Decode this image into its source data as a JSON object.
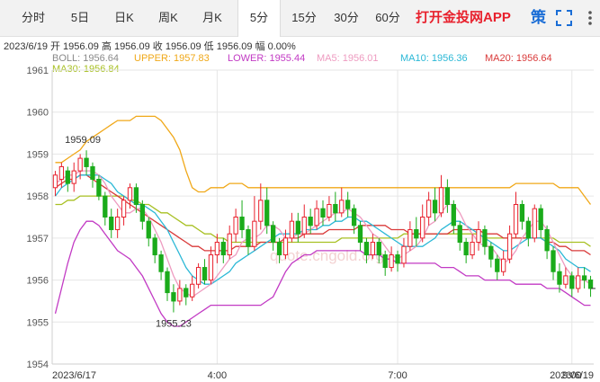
{
  "tabs": [
    {
      "label": "分时",
      "active": false
    },
    {
      "label": "5日",
      "active": false
    },
    {
      "label": "日K",
      "active": false
    },
    {
      "label": "周K",
      "active": false
    },
    {
      "label": "月K",
      "active": false
    },
    {
      "label": "5分",
      "active": true
    },
    {
      "label": "15分",
      "active": false
    },
    {
      "label": "30分",
      "active": false
    },
    {
      "label": "60分",
      "active": false
    }
  ],
  "app_link": "打开金投网APP",
  "strategy": "策",
  "icons": {
    "fullscreen": "fullscreen-icon",
    "more": "more-vertical-icon"
  },
  "info": {
    "date": "2023/6/19",
    "open": "开 1956.09",
    "high": "高 1956.09",
    "close": "收 1956.09",
    "low": "低 1956.09",
    "amplitude": "幅 0.00%"
  },
  "legend": {
    "boll": "BOLL: 1956.64",
    "upper": "UPPER: 1957.83",
    "lower": "LOWER: 1955.44",
    "ma5": "MA5: 1956.01",
    "ma10": "MA10: 1956.36",
    "ma20": "MA20: 1956.64",
    "ma30": "MA30: 1956.84"
  },
  "colors": {
    "up": "#e8212d",
    "down": "#1aab1a",
    "upper": "#f0a818",
    "lower": "#c23ac4",
    "boll": "#9a9a9a",
    "ma5": "#ee9bc0",
    "ma10": "#2bb8d6",
    "ma20": "#d93a3a",
    "ma30": "#a8c023",
    "grid": "#e6e6e6"
  },
  "watermark": "quote.cngold.org",
  "chart_data": {
    "type": "candlestick",
    "ylim": [
      1954,
      1961
    ],
    "yticks": [
      "1961",
      "1960",
      "1959",
      "1958",
      "1957",
      "1956",
      "1955",
      "1954"
    ],
    "xticks": [
      "2023/6/17",
      "4:00",
      "7:00",
      "9:00",
      "2023/6/19"
    ],
    "annotations": [
      {
        "text": "1959.09"
      },
      {
        "text": "1955.23"
      }
    ],
    "candles": [
      [
        1958.2,
        1958.5,
        1958.0,
        1958.6
      ],
      [
        1958.4,
        1958.7,
        1958.2,
        1958.8
      ],
      [
        1958.6,
        1958.3,
        1958.1,
        1958.7
      ],
      [
        1958.3,
        1958.6,
        1958.1,
        1958.8
      ],
      [
        1958.6,
        1958.9,
        1958.4,
        1959.0
      ],
      [
        1958.9,
        1958.7,
        1958.5,
        1959.09
      ],
      [
        1958.7,
        1958.4,
        1958.2,
        1958.8
      ],
      [
        1958.4,
        1958.0,
        1957.9,
        1958.5
      ],
      [
        1958.0,
        1957.5,
        1957.3,
        1958.1
      ],
      [
        1957.5,
        1957.2,
        1957.0,
        1957.7
      ],
      [
        1957.2,
        1957.5,
        1957.0,
        1957.7
      ],
      [
        1957.5,
        1957.9,
        1957.3,
        1958.0
      ],
      [
        1957.9,
        1958.2,
        1957.7,
        1958.3
      ],
      [
        1958.2,
        1957.8,
        1957.6,
        1958.3
      ],
      [
        1957.8,
        1957.4,
        1957.2,
        1957.9
      ],
      [
        1957.4,
        1957.0,
        1956.8,
        1957.5
      ],
      [
        1957.0,
        1956.6,
        1956.4,
        1957.1
      ],
      [
        1956.6,
        1956.2,
        1956.0,
        1956.7
      ],
      [
        1956.2,
        1955.7,
        1955.5,
        1956.3
      ],
      [
        1955.7,
        1955.5,
        1955.23,
        1955.9
      ],
      [
        1955.5,
        1955.8,
        1955.4,
        1956.0
      ],
      [
        1955.8,
        1955.6,
        1955.4,
        1955.9
      ],
      [
        1955.6,
        1955.9,
        1955.5,
        1956.1
      ],
      [
        1955.9,
        1956.3,
        1955.8,
        1956.4
      ],
      [
        1956.3,
        1956.0,
        1955.9,
        1956.5
      ],
      [
        1956.0,
        1956.6,
        1955.9,
        1956.8
      ],
      [
        1956.6,
        1956.9,
        1956.4,
        1957.1
      ],
      [
        1956.9,
        1956.6,
        1956.4,
        1957.0
      ],
      [
        1956.6,
        1957.1,
        1956.5,
        1957.3
      ],
      [
        1957.1,
        1957.5,
        1956.9,
        1957.7
      ],
      [
        1957.5,
        1957.2,
        1957.0,
        1957.9
      ],
      [
        1957.2,
        1956.8,
        1956.6,
        1957.3
      ],
      [
        1956.8,
        1957.4,
        1956.7,
        1958.0
      ],
      [
        1957.4,
        1957.9,
        1957.2,
        1958.3
      ],
      [
        1957.9,
        1957.3,
        1957.1,
        1958.2
      ],
      [
        1957.3,
        1956.9,
        1956.7,
        1957.4
      ],
      [
        1956.9,
        1956.6,
        1956.4,
        1957.0
      ],
      [
        1956.6,
        1957.0,
        1956.5,
        1957.2
      ],
      [
        1957.0,
        1957.4,
        1956.9,
        1957.6
      ],
      [
        1957.4,
        1957.1,
        1956.9,
        1957.6
      ],
      [
        1957.1,
        1957.5,
        1957.0,
        1957.8
      ],
      [
        1957.5,
        1957.3,
        1957.1,
        1957.7
      ],
      [
        1957.3,
        1957.7,
        1957.2,
        1957.9
      ],
      [
        1957.7,
        1957.5,
        1957.3,
        1957.9
      ],
      [
        1957.5,
        1957.8,
        1957.4,
        1958.0
      ],
      [
        1957.8,
        1957.6,
        1957.4,
        1958.1
      ],
      [
        1957.6,
        1957.9,
        1957.5,
        1958.2
      ],
      [
        1957.9,
        1957.7,
        1957.5,
        1958.1
      ],
      [
        1957.7,
        1957.3,
        1957.1,
        1957.8
      ],
      [
        1957.3,
        1956.9,
        1956.7,
        1957.4
      ],
      [
        1956.9,
        1956.6,
        1956.4,
        1957.0
      ],
      [
        1956.6,
        1956.9,
        1956.5,
        1957.1
      ],
      [
        1956.9,
        1956.6,
        1956.4,
        1957.0
      ],
      [
        1956.6,
        1956.3,
        1956.1,
        1956.7
      ],
      [
        1956.3,
        1956.6,
        1956.2,
        1956.8
      ],
      [
        1956.6,
        1956.4,
        1956.2,
        1956.7
      ],
      [
        1956.4,
        1956.8,
        1956.3,
        1957.0
      ],
      [
        1956.8,
        1957.2,
        1956.7,
        1957.4
      ],
      [
        1957.2,
        1957.0,
        1956.8,
        1957.5
      ],
      [
        1957.0,
        1957.5,
        1956.9,
        1957.8
      ],
      [
        1957.5,
        1957.9,
        1957.3,
        1958.1
      ],
      [
        1957.9,
        1957.6,
        1957.4,
        1958.2
      ],
      [
        1957.6,
        1958.2,
        1957.5,
        1958.5
      ],
      [
        1958.2,
        1957.8,
        1957.6,
        1958.4
      ],
      [
        1957.8,
        1957.3,
        1957.1,
        1957.9
      ],
      [
        1957.3,
        1956.9,
        1956.7,
        1957.4
      ],
      [
        1956.9,
        1956.6,
        1956.4,
        1957.0
      ],
      [
        1956.6,
        1956.9,
        1956.5,
        1957.1
      ],
      [
        1956.9,
        1957.2,
        1956.7,
        1957.4
      ],
      [
        1957.2,
        1956.8,
        1956.6,
        1957.3
      ],
      [
        1956.8,
        1956.5,
        1956.3,
        1956.9
      ],
      [
        1956.5,
        1956.2,
        1956.0,
        1956.6
      ],
      [
        1956.2,
        1956.5,
        1956.1,
        1956.7
      ],
      [
        1956.5,
        1957.1,
        1956.4,
        1957.3
      ],
      [
        1957.1,
        1957.8,
        1957.0,
        1958.1
      ],
      [
        1957.8,
        1957.4,
        1957.2,
        1957.9
      ],
      [
        1957.4,
        1957.0,
        1956.8,
        1957.5
      ],
      [
        1957.0,
        1957.7,
        1956.9,
        1957.8
      ],
      [
        1957.7,
        1957.2,
        1957.0,
        1957.8
      ],
      [
        1957.2,
        1956.7,
        1956.5,
        1957.3
      ],
      [
        1956.7,
        1956.2,
        1956.0,
        1956.8
      ],
      [
        1956.2,
        1955.9,
        1955.7,
        1956.4
      ],
      [
        1955.9,
        1956.1,
        1955.8,
        1956.3
      ],
      [
        1956.1,
        1955.8,
        1955.6,
        1956.2
      ],
      [
        1955.8,
        1956.1,
        1955.7,
        1956.3
      ],
      [
        1956.1,
        1956.0,
        1955.8,
        1956.3
      ],
      [
        1956.0,
        1955.8,
        1955.6,
        1956.1
      ]
    ],
    "upper": [
      1958.8,
      1958.8,
      1958.9,
      1959.0,
      1959.1,
      1959.3,
      1959.4,
      1959.5,
      1959.6,
      1959.7,
      1959.8,
      1959.8,
      1959.8,
      1959.9,
      1959.9,
      1959.9,
      1959.9,
      1959.8,
      1959.6,
      1959.4,
      1959.1,
      1958.6,
      1958.2,
      1958.1,
      1958.1,
      1958.2,
      1958.2,
      1958.2,
      1958.3,
      1958.3,
      1958.3,
      1958.2,
      1958.2,
      1958.2,
      1958.2,
      1958.2,
      1958.2,
      1958.2,
      1958.2,
      1958.2,
      1958.2,
      1958.2,
      1958.2,
      1958.2,
      1958.2,
      1958.2,
      1958.2,
      1958.2,
      1958.2,
      1958.2,
      1958.2,
      1958.2,
      1958.2,
      1958.2,
      1958.2,
      1958.2,
      1958.2,
      1958.2,
      1958.2,
      1958.2,
      1958.2,
      1958.2,
      1958.2,
      1958.2,
      1958.2,
      1958.2,
      1958.2,
      1958.2,
      1958.2,
      1958.2,
      1958.2,
      1958.2,
      1958.2,
      1958.2,
      1958.3,
      1958.3,
      1958.3,
      1958.3,
      1958.3,
      1958.3,
      1958.3,
      1958.2,
      1958.2,
      1958.2,
      1958.2,
      1958.0,
      1957.8
    ],
    "lower": [
      1955.2,
      1955.8,
      1956.4,
      1956.9,
      1957.2,
      1957.4,
      1957.4,
      1957.3,
      1957.1,
      1956.9,
      1956.7,
      1956.6,
      1956.5,
      1956.3,
      1956.1,
      1955.8,
      1955.5,
      1955.2,
      1955.0,
      1954.9,
      1954.9,
      1955.0,
      1955.1,
      1955.2,
      1955.3,
      1955.4,
      1955.4,
      1955.4,
      1955.4,
      1955.4,
      1955.4,
      1955.4,
      1955.4,
      1955.4,
      1955.5,
      1955.6,
      1955.9,
      1956.2,
      1956.4,
      1956.5,
      1956.6,
      1956.6,
      1956.7,
      1956.7,
      1956.7,
      1956.7,
      1956.7,
      1956.7,
      1956.7,
      1956.7,
      1956.6,
      1956.6,
      1956.6,
      1956.5,
      1956.5,
      1956.4,
      1956.4,
      1956.4,
      1956.4,
      1956.4,
      1956.4,
      1956.4,
      1956.3,
      1956.3,
      1956.3,
      1956.2,
      1956.1,
      1956.1,
      1956.1,
      1956.0,
      1956.0,
      1956.0,
      1956.0,
      1956.0,
      1955.9,
      1955.9,
      1955.9,
      1955.9,
      1955.9,
      1955.8,
      1955.8,
      1955.8,
      1955.7,
      1955.6,
      1955.5,
      1955.4,
      1955.4
    ],
    "boll": [
      1957.7,
      1957.8,
      1957.9,
      1958.0,
      1958.1,
      1958.2,
      1958.2,
      1958.2,
      1958.1,
      1958.0,
      1957.9,
      1957.9,
      1957.9,
      1957.9,
      1957.9,
      1957.8,
      1957.7,
      1957.6,
      1957.5,
      1957.4,
      1957.3,
      1957.2,
      1957.1,
      1957.0,
      1956.9,
      1956.8,
      1956.8,
      1956.8,
      1956.8,
      1956.8,
      1956.9,
      1956.9,
      1956.9,
      1956.9,
      1956.9,
      1956.9,
      1956.9,
      1956.9,
      1957.0,
      1957.0,
      1957.0,
      1957.0,
      1957.1,
      1957.1,
      1957.2,
      1957.2,
      1957.2,
      1957.2,
      1957.3,
      1957.3,
      1957.3,
      1957.3,
      1957.3,
      1957.3,
      1957.2,
      1957.2,
      1957.2,
      1957.2,
      1957.2,
      1957.2,
      1957.2,
      1957.2,
      1957.2,
      1957.2,
      1957.2,
      1957.2,
      1957.2,
      1957.2,
      1957.2,
      1957.2,
      1957.1,
      1957.1,
      1957.1,
      1957.1,
      1957.1,
      1957.1,
      1957.1,
      1957.0,
      1957.0,
      1957.0,
      1956.9,
      1956.9,
      1956.8,
      1956.8,
      1956.7,
      1956.7,
      1956.6
    ],
    "ma5": [
      1958.3,
      1958.4,
      1958.5,
      1958.5,
      1958.6,
      1958.6,
      1958.6,
      1958.5,
      1958.3,
      1958.0,
      1957.8,
      1957.6,
      1957.6,
      1957.7,
      1957.7,
      1957.5,
      1957.2,
      1956.9,
      1956.5,
      1956.1,
      1955.8,
      1955.7,
      1955.6,
      1955.7,
      1955.8,
      1955.9,
      1956.1,
      1956.3,
      1956.5,
      1956.6,
      1956.9,
      1957.0,
      1957.0,
      1957.1,
      1957.3,
      1957.3,
      1957.2,
      1957.0,
      1957.0,
      1957.1,
      1957.1,
      1957.2,
      1957.3,
      1957.4,
      1957.5,
      1957.6,
      1957.6,
      1957.7,
      1957.6,
      1957.5,
      1957.3,
      1957.1,
      1957.0,
      1956.8,
      1956.6,
      1956.5,
      1956.6,
      1956.7,
      1956.8,
      1957.0,
      1957.3,
      1957.4,
      1957.6,
      1957.8,
      1957.8,
      1957.6,
      1957.3,
      1957.1,
      1956.9,
      1956.8,
      1956.8,
      1956.6,
      1956.4,
      1956.5,
      1956.7,
      1957.0,
      1957.2,
      1957.4,
      1957.4,
      1957.2,
      1956.9,
      1956.6,
      1956.3,
      1956.1,
      1956.0,
      1956.0,
      1955.9
    ],
    "ma10": [
      1958.0,
      1958.2,
      1958.3,
      1958.4,
      1958.5,
      1958.5,
      1958.5,
      1958.5,
      1958.4,
      1958.3,
      1958.1,
      1958.0,
      1957.9,
      1957.8,
      1957.8,
      1957.7,
      1957.6,
      1957.4,
      1957.2,
      1956.9,
      1956.6,
      1956.3,
      1956.1,
      1956.0,
      1955.9,
      1955.9,
      1956.0,
      1956.1,
      1956.2,
      1956.4,
      1956.5,
      1956.6,
      1956.7,
      1956.8,
      1956.9,
      1957.0,
      1957.1,
      1957.1,
      1957.1,
      1957.1,
      1957.2,
      1957.2,
      1957.2,
      1957.3,
      1957.3,
      1957.4,
      1957.4,
      1957.5,
      1957.5,
      1957.4,
      1957.4,
      1957.3,
      1957.2,
      1957.1,
      1957.0,
      1956.9,
      1956.8,
      1956.8,
      1956.8,
      1956.8,
      1956.9,
      1957.0,
      1957.2,
      1957.3,
      1957.4,
      1957.4,
      1957.3,
      1957.2,
      1957.1,
      1957.0,
      1956.9,
      1956.8,
      1956.7,
      1956.7,
      1956.8,
      1956.9,
      1957.0,
      1957.0,
      1957.0,
      1956.9,
      1956.8,
      1956.7,
      1956.5,
      1956.4,
      1956.3,
      1956.3,
      1956.2
    ],
    "ma20": [
      1958.2,
      1958.3,
      1958.4,
      1958.4,
      1958.5,
      1958.5,
      1958.4,
      1958.3,
      1958.2,
      1958.1,
      1958.0,
      1957.9,
      1957.8,
      1957.7,
      1957.6,
      1957.5,
      1957.4,
      1957.3,
      1957.2,
      1957.1,
      1957.0,
      1956.9,
      1956.8,
      1956.8,
      1956.7,
      1956.7,
      1956.7,
      1956.7,
      1956.7,
      1956.8,
      1956.8,
      1956.8,
      1956.8,
      1956.9,
      1956.9,
      1956.9,
      1956.9,
      1957.0,
      1957.0,
      1957.0,
      1957.1,
      1957.1,
      1957.1,
      1957.1,
      1957.2,
      1957.2,
      1957.2,
      1957.2,
      1957.2,
      1957.3,
      1957.3,
      1957.3,
      1957.3,
      1957.3,
      1957.2,
      1957.2,
      1957.2,
      1957.1,
      1957.1,
      1957.1,
      1957.1,
      1957.1,
      1957.1,
      1957.1,
      1957.2,
      1957.2,
      1957.2,
      1957.2,
      1957.2,
      1957.1,
      1957.1,
      1957.1,
      1957.0,
      1957.0,
      1957.0,
      1957.0,
      1957.0,
      1957.0,
      1957.0,
      1956.9,
      1956.9,
      1956.8,
      1956.8,
      1956.7,
      1956.7,
      1956.7,
      1956.6
    ],
    "ma30": [
      1957.8,
      1957.8,
      1957.9,
      1957.9,
      1958.0,
      1958.0,
      1958.0,
      1958.0,
      1958.0,
      1958.0,
      1958.0,
      1958.0,
      1957.9,
      1957.9,
      1957.8,
      1957.8,
      1957.7,
      1957.6,
      1957.6,
      1957.5,
      1957.4,
      1957.3,
      1957.3,
      1957.2,
      1957.1,
      1957.1,
      1957.0,
      1957.0,
      1956.9,
      1956.9,
      1956.9,
      1956.9,
      1956.9,
      1956.9,
      1956.9,
      1956.9,
      1956.9,
      1956.9,
      1956.9,
      1956.9,
      1956.9,
      1956.9,
      1956.9,
      1956.9,
      1956.9,
      1956.9,
      1957.0,
      1957.0,
      1957.0,
      1957.0,
      1957.0,
      1957.0,
      1957.0,
      1957.0,
      1957.0,
      1957.0,
      1957.1,
      1957.1,
      1957.1,
      1957.1,
      1957.1,
      1957.1,
      1957.1,
      1957.1,
      1957.1,
      1957.1,
      1957.1,
      1957.1,
      1957.1,
      1957.0,
      1957.0,
      1957.0,
      1957.0,
      1957.0,
      1957.0,
      1957.0,
      1957.0,
      1957.0,
      1957.0,
      1957.0,
      1957.0,
      1956.9,
      1956.9,
      1956.9,
      1956.9,
      1956.9,
      1956.8
    ]
  }
}
